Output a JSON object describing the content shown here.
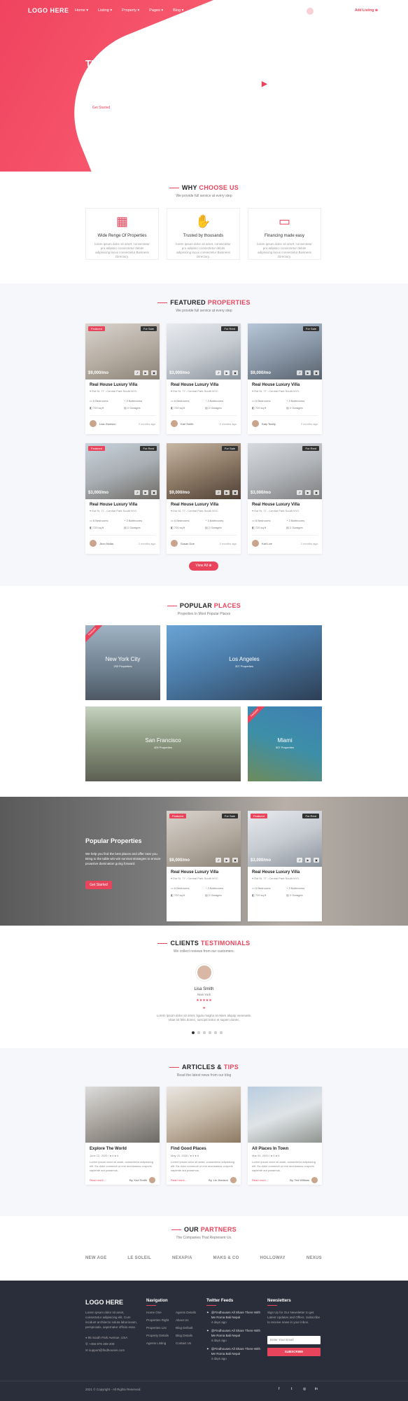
{
  "nav": {
    "logo": "LOGO HERE",
    "links": [
      "Home ▾",
      "Listing ▾",
      "Property ▾",
      "Pages ▾",
      "Blog ▾",
      "Contact"
    ],
    "lang": "ENG ▾",
    "signin": "Sign In",
    "user": "Hi, Mary! ▾",
    "add_listing": "Add Listing ⊕"
  },
  "hero": {
    "title": "THE BEST WAY TO FIND YOUR DREAM HOME",
    "subtitle": "With over 800,000 active listings, Findhouses has the largest inventory of apartments in the United States.",
    "button": "Get Started",
    "play_icon": "▶"
  },
  "why": {
    "title_a": "WHY ",
    "title_b": "CHOOSE US",
    "subtitle": "We provide full service at every step",
    "cards": [
      {
        "title": "Wide Renge Of Properties",
        "desc": "lorem ipsum dolor sit amet, consectetur pro adipisici consectetur debits adipisicing lacus consectetur Business Directory.",
        "icon": "building-icon",
        "glyph": "▦"
      },
      {
        "title": "Trusted by thousands",
        "desc": "lorem ipsum dolor sit amet, consectetur pro adipisici consectetur debits adipisicing lacus consectetur Business Directory.",
        "icon": "handshake-icon",
        "glyph": "✋"
      },
      {
        "title": "Financing made easy",
        "desc": "lorem ipsum dolor sit amet, consectetur pro adipisici consectetur debits adipisicing lacus consectetur Business Directory.",
        "icon": "wallet-icon",
        "glyph": "▭"
      }
    ]
  },
  "featured": {
    "title_a": "FEATURED ",
    "title_b": "PROPERTIES",
    "subtitle": "We provide full service at every step",
    "view_all": "View All ⊕",
    "cards": [
      {
        "featured": "Featured",
        "status": "For Sale",
        "price": "$9,000/mo",
        "title": "Real House Luxury Villa",
        "addr": "Est St, 77 - Central Park South NYC",
        "beds": "6 Bedrooms",
        "baths": "3 Bathrooms",
        "area": "720 sq ft",
        "garage": "2 Garages",
        "agent": "Lisa Jhonson",
        "time": "2 months ago"
      },
      {
        "featured": "",
        "status": "For Rent",
        "price": "$3,000/mo",
        "title": "Real House Luxury Villa",
        "addr": "Est St, 77 - Central Park South NYC",
        "beds": "6 Bedrooms",
        "baths": "3 Bathrooms",
        "area": "720 sq ft",
        "garage": "2 Garages",
        "agent": "Karl Smith",
        "time": "2 months ago"
      },
      {
        "featured": "",
        "status": "For Sale",
        "price": "$9,000/mo",
        "title": "Real House Luxury Villa",
        "addr": "Est St, 77 - Central Park South NYC",
        "beds": "6 Bedrooms",
        "baths": "3 Bathrooms",
        "area": "720 sq ft",
        "garage": "2 Garages",
        "agent": "Katy Teddy",
        "time": "2 months ago"
      },
      {
        "featured": "Featured",
        "status": "For Rent",
        "price": "$3,000/mo",
        "title": "Real House Luxury Villa",
        "addr": "Est St, 77 - Central Park South NYC",
        "beds": "6 Bedrooms",
        "baths": "3 Bathrooms",
        "area": "720 sq ft",
        "garage": "2 Garages",
        "agent": "Jhon Nolan",
        "time": "2 months ago"
      },
      {
        "featured": "",
        "status": "For Sale",
        "price": "$9,000/mo",
        "title": "Real House Luxury Villa",
        "addr": "Est St, 77 - Central Park South NYC",
        "beds": "6 Bedrooms",
        "baths": "3 Bathrooms",
        "area": "720 sq ft",
        "garage": "2 Garages",
        "agent": "Susan Doe",
        "time": "2 months ago"
      },
      {
        "featured": "",
        "status": "For Rent",
        "price": "$3,000/mo",
        "title": "Real House Luxury Villa",
        "addr": "Est St, 77 - Central Park South NYC",
        "beds": "6 Bedrooms",
        "baths": "3 Bathrooms",
        "area": "720 sq ft",
        "garage": "2 Garages",
        "agent": "Karl Lee",
        "time": "2 months ago"
      }
    ]
  },
  "places": {
    "title_a": "POPULAR ",
    "title_b": "PLACES",
    "subtitle": "Properties In Most Popular Places",
    "items": [
      {
        "name": "New York City",
        "count": "203 Properties",
        "ribbon": "Featured"
      },
      {
        "name": "Los Angeles",
        "count": "307 Properties",
        "ribbon": ""
      },
      {
        "name": "San Francisco",
        "count": "409 Properties",
        "ribbon": ""
      },
      {
        "name": "Miami",
        "count": "507 Properties",
        "ribbon": "Featured"
      }
    ]
  },
  "promo": {
    "title": "Popular Properties",
    "text": "We help you find the best places and offer near you. Bring to the table win-win survival strategies to ensure proactive domination going forward.",
    "button": "Get Started",
    "cards": [
      {
        "featured": "Featured",
        "status": "For Sale",
        "price": "$9,000/mo",
        "title": "Real House Luxury Villa",
        "addr": "Est St, 77 - Central Park South NYC",
        "beds": "6 Bedrooms",
        "baths": "3 Bathrooms",
        "area": "720 sq ft",
        "garage": "2 Garages"
      },
      {
        "featured": "Featured",
        "status": "For Rent",
        "price": "$3,000/mo",
        "title": "Real House Luxury Villa",
        "addr": "Est St, 77 - Central Park South NYC",
        "beds": "6 Bedrooms",
        "baths": "3 Bathrooms",
        "area": "720 sq ft",
        "garage": "2 Garages"
      }
    ]
  },
  "testimonials": {
    "title_a": "CLIENTS ",
    "title_b": "TESTIMONIALS",
    "subtitle": "We collect reviews from our customers.",
    "name": "Lisa Smith",
    "city": "New York",
    "stars": "★★★★★",
    "quote_mark": "❝",
    "text": "Lorem ipsum dolor sit amet, ligula magna at etiam aliquip venenatis. Vitae sit felis donec, suscipit tortor et sapien donec."
  },
  "articles": {
    "title_a": "ARTICLES & ",
    "title_b": "TIPS",
    "subtitle": "Read the latest news from our blog",
    "items": [
      {
        "title": "Explore The World",
        "meta": "June 12, 2020 / ● 6  ● 6",
        "desc": "Lorem ipsum dolor sit amet, consectetur adipisicing elit. Ea dolor commodi ut rem accusamus corporis sapiente aut possimus.",
        "read": "Read more...",
        "author": "By, Karl Smith"
      },
      {
        "title": "Find Good Places",
        "meta": "May 20, 2020 / ● 6  ● 6",
        "desc": "Lorem ipsum dolor sit amet, consectetur adipisicing elit. Ea dolor commodi ut rem accusamus corporis sapiente aut possimus.",
        "read": "Read more...",
        "author": "By, Lis Jhonson"
      },
      {
        "title": "All Places In Town",
        "meta": "Mar 09, 2020 / ● 6  ● 6",
        "desc": "Lorem ipsum dolor sit amet, consectetur adipisicing elit. Ea dolor commodi ut rem accusamus corporis sapiente aut possimus.",
        "read": "Read more...",
        "author": "By, Ted Willians"
      }
    ]
  },
  "partners": {
    "title_a": "OUR ",
    "title_b": "PARTNERS",
    "subtitle": "The Companies That Represent Us.",
    "logos": [
      "NEW AGE",
      "LE SOLEIL",
      "NEXAPIA",
      "MAKS & CO",
      "HOLLOWAY",
      "NEXUS"
    ]
  },
  "footer": {
    "logo": "LOGO HERE",
    "about": "Lorem ipsum dolor sit amet, consectetur adipisicing elit. Cum incidunt architecto soluta laboriosam, perspiciatis, aspernatur officiis esse.",
    "address": "95 South Park Avenue, USA",
    "phone": "+456 875 369 208",
    "email": "support@findhouses.com",
    "nav_title": "Navigation",
    "nav_col1": [
      "Home One",
      "Properties Right",
      "Properties List",
      "Property Details",
      "Agents Listing"
    ],
    "nav_col2": [
      "Agents Details",
      "About Us",
      "Blog Default",
      "Blog Details",
      "Contact Us"
    ],
    "twitter_title": "Twitter Feeds",
    "tweets": [
      {
        "text": "@Findhouses All Share There With Me Roma Bali Nepal",
        "time": "4 days ago"
      },
      {
        "text": "@Findhouses All Share There With Me Roma Bali Nepal",
        "time": "4 days ago"
      },
      {
        "text": "@Findhouses All Share There With Me Roma Bali Nepal",
        "time": "4 days ago"
      }
    ],
    "news_title": "Newsletters",
    "news_text": "Sign Up for Our Newsletter to get Latest Updates and Offers. Subscribe to receive news in your inbox.",
    "news_placeholder": "Enter Your Email",
    "subscribe": "SUBSCRIBE",
    "copyright": "2021 © Copyright - All Rights Reserved.",
    "social": [
      "f",
      "t",
      "◎",
      "in"
    ]
  },
  "colors": {
    "accent": "#e8455c",
    "footer": "#2a2d3a"
  }
}
